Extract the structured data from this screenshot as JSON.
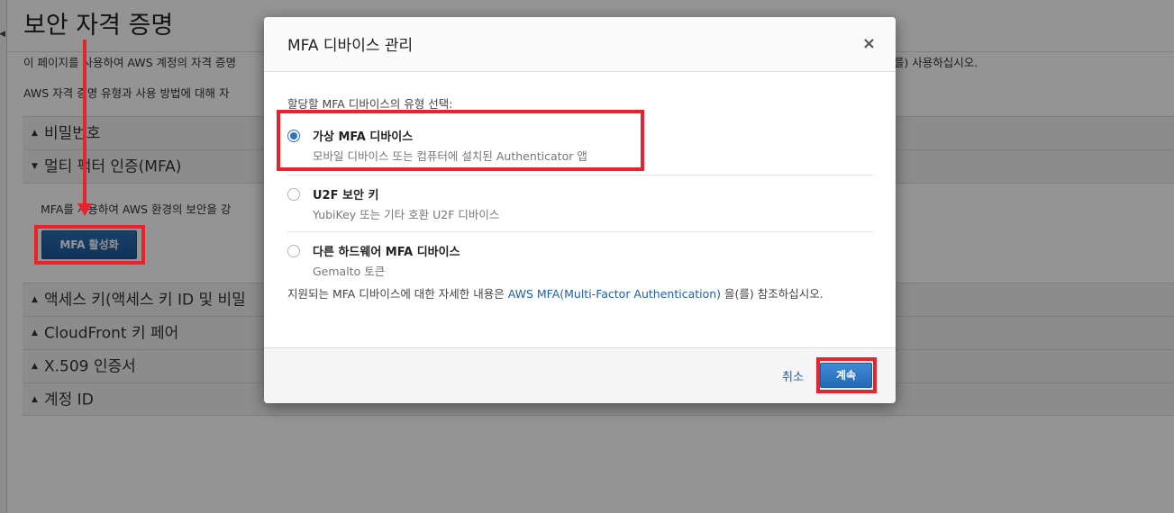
{
  "page": {
    "title": "보안 자격 증명",
    "intro": "이 페이지를 사용하여 AWS 계정의 자격 증명",
    "intro_tail": "(를) 사용하십시오.",
    "intro2": "AWS 자격 증명 유형과 사용 방법에 대해 자"
  },
  "accordion": {
    "password": "비밀번호",
    "mfa": "멀티 팩터 인증(MFA)",
    "mfa_desc": "MFA를 사용하여 AWS 환경의 보안을 강",
    "mfa_enable_button": "MFA 활성화",
    "access_keys": "액세스 키(액세스 키 ID 및 비밀",
    "cloudfront": "CloudFront 키 페어",
    "x509": "X.509 인증서",
    "account_id": "계정 ID"
  },
  "modal": {
    "title": "MFA 디바이스 관리",
    "close_glyph": "×",
    "prompt": "할당할 MFA 디바이스의 유형 선택:",
    "options": [
      {
        "title": "가상 MFA 디바이스",
        "subtitle": "모바일 디바이스 또는 컴퓨터에 설치된 Authenticator 앱",
        "selected": true
      },
      {
        "title": "U2F 보안 키",
        "subtitle": "YubiKey 또는 기타 호환 U2F 디바이스",
        "selected": false
      },
      {
        "title": "다른 하드웨어 MFA 디바이스",
        "subtitle": "Gemalto 토큰",
        "selected": false
      }
    ],
    "info_prefix": "지원되는 MFA 디바이스에 대한 자세한 내용은 ",
    "info_link": "AWS MFA(Multi-Factor Authentication)",
    "info_suffix": " 을(를) 참조하십시오.",
    "cancel": "취소",
    "continue": "계속"
  },
  "icons": {
    "collapse": "◀",
    "expanded": "▼",
    "collapsed": "▲"
  },
  "colors": {
    "highlight": "#e8232b",
    "primary_button": "#2469b6",
    "link": "#1f5fa8"
  }
}
